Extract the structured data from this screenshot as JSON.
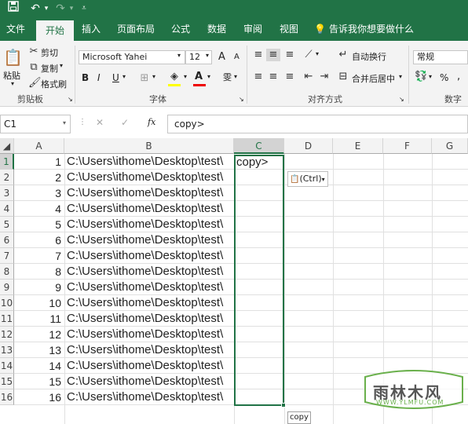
{
  "qat": {
    "save_icon": "save-icon",
    "undo_icon": "undo-icon",
    "redo_icon": "redo-icon",
    "customize_icon": "customize-icon"
  },
  "tabs": [
    "文件",
    "开始",
    "插入",
    "页面布局",
    "公式",
    "数据",
    "审阅",
    "视图"
  ],
  "tell_me": "告诉我你想要做什么",
  "clipboard": {
    "paste": "粘贴",
    "cut": "剪切",
    "copy": "复制",
    "format_painter": "格式刷",
    "group": "剪贴板"
  },
  "font": {
    "name": "Microsoft Yahei",
    "size": "12",
    "bold": "B",
    "italic": "I",
    "underline": "U",
    "group": "字体",
    "grow": "A",
    "shrink": "A",
    "color_a": "A",
    "phonetic": "雯"
  },
  "alignment": {
    "wrap": "自动换行",
    "merge": "合并后居中",
    "group": "对齐方式"
  },
  "number": {
    "format": "常规",
    "group": "数字",
    "percent": "%",
    "comma": ","
  },
  "formula_bar": {
    "name_box": "C1",
    "value": "copy>",
    "cancel": "✕",
    "enter": "✓",
    "fx": "fx"
  },
  "columns": [
    "A",
    "B",
    "C",
    "D",
    "E",
    "F",
    "G"
  ],
  "rows": [
    {
      "n": "1",
      "a": "1",
      "b": "C:\\Users\\ithome\\Desktop\\test\\"
    },
    {
      "n": "2",
      "a": "2",
      "b": "C:\\Users\\ithome\\Desktop\\test\\"
    },
    {
      "n": "3",
      "a": "3",
      "b": "C:\\Users\\ithome\\Desktop\\test\\"
    },
    {
      "n": "4",
      "a": "4",
      "b": "C:\\Users\\ithome\\Desktop\\test\\"
    },
    {
      "n": "5",
      "a": "5",
      "b": "C:\\Users\\ithome\\Desktop\\test\\"
    },
    {
      "n": "6",
      "a": "6",
      "b": "C:\\Users\\ithome\\Desktop\\test\\"
    },
    {
      "n": "7",
      "a": "7",
      "b": "C:\\Users\\ithome\\Desktop\\test\\"
    },
    {
      "n": "8",
      "a": "8",
      "b": "C:\\Users\\ithome\\Desktop\\test\\"
    },
    {
      "n": "9",
      "a": "9",
      "b": "C:\\Users\\ithome\\Desktop\\test\\"
    },
    {
      "n": "10",
      "a": "10",
      "b": "C:\\Users\\ithome\\Desktop\\test\\"
    },
    {
      "n": "11",
      "a": "11",
      "b": "C:\\Users\\ithome\\Desktop\\test\\"
    },
    {
      "n": "12",
      "a": "12",
      "b": "C:\\Users\\ithome\\Desktop\\test\\"
    },
    {
      "n": "13",
      "a": "13",
      "b": "C:\\Users\\ithome\\Desktop\\test\\"
    },
    {
      "n": "14",
      "a": "14",
      "b": "C:\\Users\\ithome\\Desktop\\test\\"
    },
    {
      "n": "15",
      "a": "15",
      "b": "C:\\Users\\ithome\\Desktop\\test\\"
    },
    {
      "n": "16",
      "a": "16",
      "b": "C:\\Users\\ithome\\Desktop\\test\\"
    }
  ],
  "cell_c1": "copy>",
  "paste_options": "(Ctrl)",
  "tooltip": "copy",
  "watermark": {
    "title": "雨林木风",
    "url": "WWW.YLMFU.COM"
  },
  "colors": {
    "accent": "#217346",
    "ribbon": "#f3f3f3"
  }
}
